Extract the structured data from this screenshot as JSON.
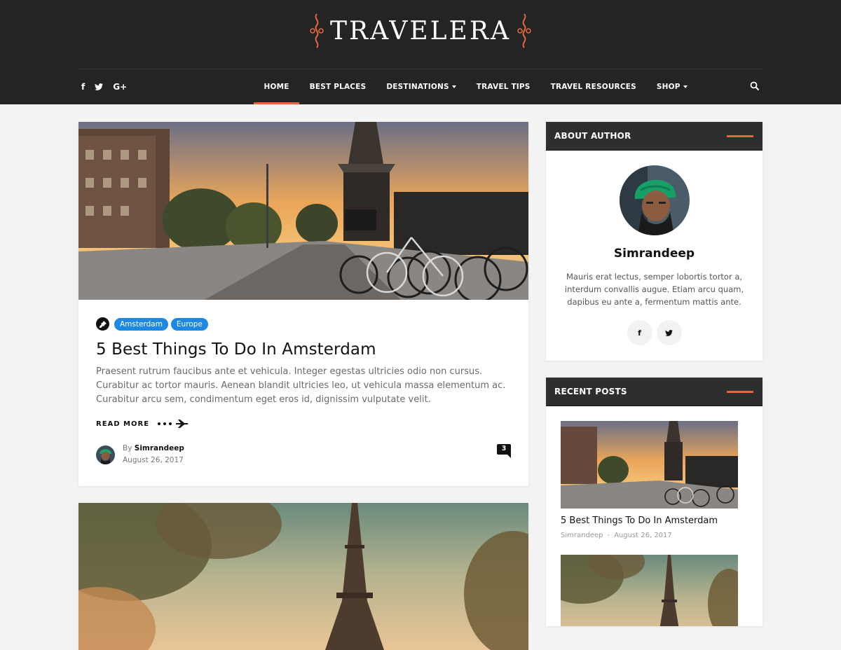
{
  "site": {
    "logo": "TRAVELERA"
  },
  "social": {
    "facebook": "f",
    "twitter": "t",
    "google": "G+"
  },
  "nav": {
    "home": "HOME",
    "best_places": "BEST PLACES",
    "destinations": "DESTINATIONS",
    "travel_tips": "TRAVEL TIPS",
    "travel_resources": "TRAVEL RESOURCES",
    "shop": "SHOP"
  },
  "post": {
    "categories": [
      "Amsterdam",
      "Europe"
    ],
    "title": "5 Best Things To Do In Amsterdam",
    "excerpt": "Praesent rutrum faucibus ante et vehicula. Integer egestas ultricies odio non cursus. Curabitur ac tortor mauris. Aenean blandit ultricies leo, ut vehicula massa elementum ac. Curabitur arcu sem, condimentum eget eros id, dignissim vulputate velit.",
    "read_more": "READ MORE",
    "by": "By",
    "author": "Simrandeep",
    "date": "August 26, 2017",
    "comments": "3"
  },
  "about": {
    "title": "ABOUT AUTHOR",
    "name": "Simrandeep",
    "bio": "Mauris erat lectus, semper lobortis tortor a, interdum convallis augue. Etiam arcu quam, dapibus eu ante a, fermentum mattis ante."
  },
  "recent": {
    "title": "RECENT POSTS",
    "items": [
      {
        "title": "5 Best Things To Do In Amsterdam",
        "author": "Simrandeep",
        "sep": "-",
        "date": "August 26, 2017"
      }
    ]
  },
  "colors": {
    "accent": "#e5673f",
    "header": "#242424",
    "badge": "#1e88e5"
  }
}
